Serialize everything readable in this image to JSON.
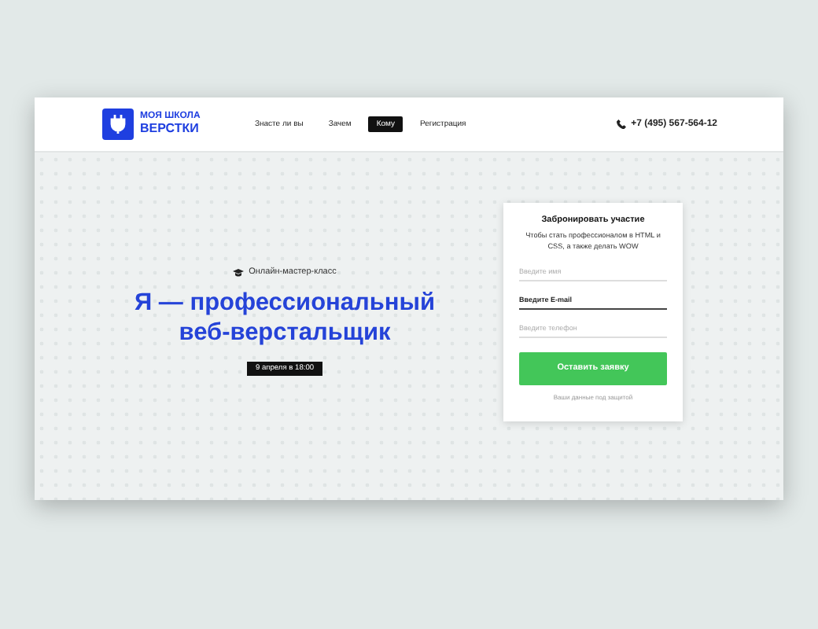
{
  "header": {
    "logo": {
      "line1": "МОЯ ШКОЛА",
      "line2": "ВЕРСТКИ"
    },
    "nav": [
      {
        "label": "Знасте ли вы",
        "selected": false
      },
      {
        "label": "Зачем",
        "selected": false
      },
      {
        "label": "Кому",
        "selected": true
      },
      {
        "label": "Регистрация",
        "selected": false
      }
    ],
    "phone": "+7 (495) 567-564-12"
  },
  "hero": {
    "eyebrow": "Онлайн-мастер-класс",
    "title_line1": "Я — профессиональный",
    "title_line2": "веб-верстальщик",
    "date": "9 апреля в 18:00"
  },
  "form": {
    "title": "Забронировать участие",
    "description": "Чтобы стать профессионалом в  HTML и CSS, а также делать WOW",
    "fields": [
      {
        "placeholder": "Введите имя",
        "focused": false
      },
      {
        "placeholder": "Введите E-mail",
        "focused": true
      },
      {
        "placeholder": "Введите телефон",
        "focused": false
      }
    ],
    "submit": "Оставить заявку",
    "note": "Ваши данные под защитой"
  }
}
